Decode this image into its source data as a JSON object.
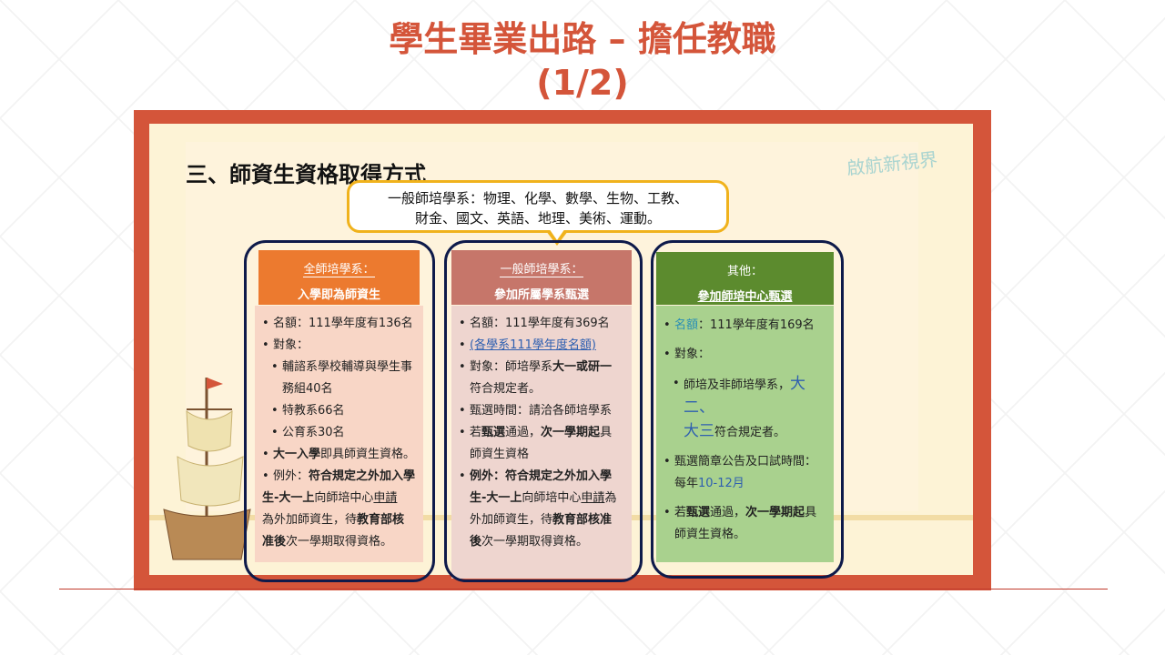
{
  "slide": {
    "title_line1": "學生畢業出路 – 擔任教職",
    "title_line2": "(1/2)",
    "section_heading": "三、師資生資格取得方式",
    "brand": "啟航新視界",
    "bubble_line1": "一般師培學系：物理、化學、數學、生物、工教、",
    "bubble_line2": "財金、國文、英語、地理、美術、運動。"
  },
  "columns": [
    {
      "head1": "全師培學系：",
      "head2": "入學即為師資生",
      "quota": "名額：111學年度有136名",
      "target_label": "對象：",
      "target1a": "輔諮系學校輔導與學生事",
      "target1b": "務組40名",
      "target2": "特教系66名",
      "target3": "公育系30名",
      "p4_bold": "大一入學",
      "p4_rest": "即具師資生資格。",
      "p5_label": "例外：",
      "p5_b1": "符合規定之外加入學",
      "p5_b2": "生-大一上",
      "p5_t1": "向師培中心",
      "p5_u": "申請",
      "p5_t2": "為外加師資生，待",
      "p5_b3": "教育部核",
      "p5_b4": "准後",
      "p5_t3": "次一學期取得資格。"
    },
    {
      "head1": "一般師培學系：",
      "head2": "參加所屬學系甄選",
      "quota": "名額：111學年度有369名",
      "link": "(各學系111學年度名額)",
      "target_t": "對象：師培學系",
      "target_b": "大一或研一",
      "target_t2": "符合規定者。",
      "time": "甄選時間：請洽各師培學系",
      "pass_t1": "若",
      "pass_b1": "甄選",
      "pass_t2": "通過，",
      "pass_b2": "次一學期起",
      "pass_t3": "具",
      "pass_t4": "師資生資格",
      "ex_label": "例外：",
      "ex_b1": "符合規定之外加入學",
      "ex_b2": "生-大一上",
      "ex_t1": "向師培中心",
      "ex_u": "申請",
      "ex_t2": "為",
      "ex_t3": "外加師資生，待",
      "ex_b3": "教育部核准",
      "ex_b4": "後",
      "ex_t4": "次一學期取得資格。"
    },
    {
      "head1": "其他：",
      "head2": "參加師培中心甄選",
      "quota_label": "名額",
      "quota_rest": "：111學年度有169名",
      "target_label": "對象：",
      "target_t1": "師培及非師培學系，",
      "target_big1": "大二、",
      "target_big2": "大三",
      "target_t2": "符合規定者。",
      "time_label": "甄選簡章公告及口試時間：",
      "time_t1": "每年",
      "time_hl": "10-12月",
      "pass_t1": "若",
      "pass_b1": "甄選",
      "pass_t2": "通過，",
      "pass_b2": "次一學期起",
      "pass_t3": "具",
      "pass_t4": "師資生資格。"
    }
  ]
}
